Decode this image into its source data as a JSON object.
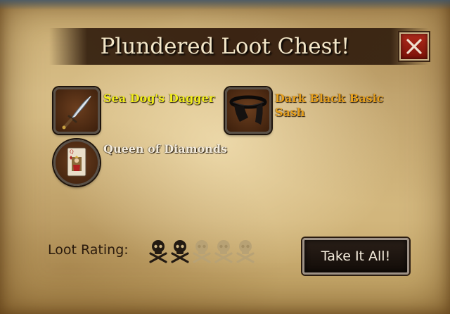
{
  "dialog": {
    "title": "Plundered Loot Chest!",
    "close_icon": "close-x-icon"
  },
  "items": [
    {
      "name": "Sea Dog's Dagger",
      "icon": "dagger-icon",
      "color": "#f2ee1a"
    },
    {
      "name_line1": "Dark Black Basic",
      "name_line2": "Sash",
      "icon": "sash-icon",
      "color": "#e8a01c"
    },
    {
      "name": "Queen of Diamonds",
      "icon": "playing-card-icon",
      "color": "#f4ecdc"
    }
  ],
  "loot_rating": {
    "label": "Loot Rating:",
    "value": 2,
    "max": 5,
    "icon": "skull-crossbones-icon"
  },
  "actions": {
    "take_all_label": "Take It All!"
  }
}
